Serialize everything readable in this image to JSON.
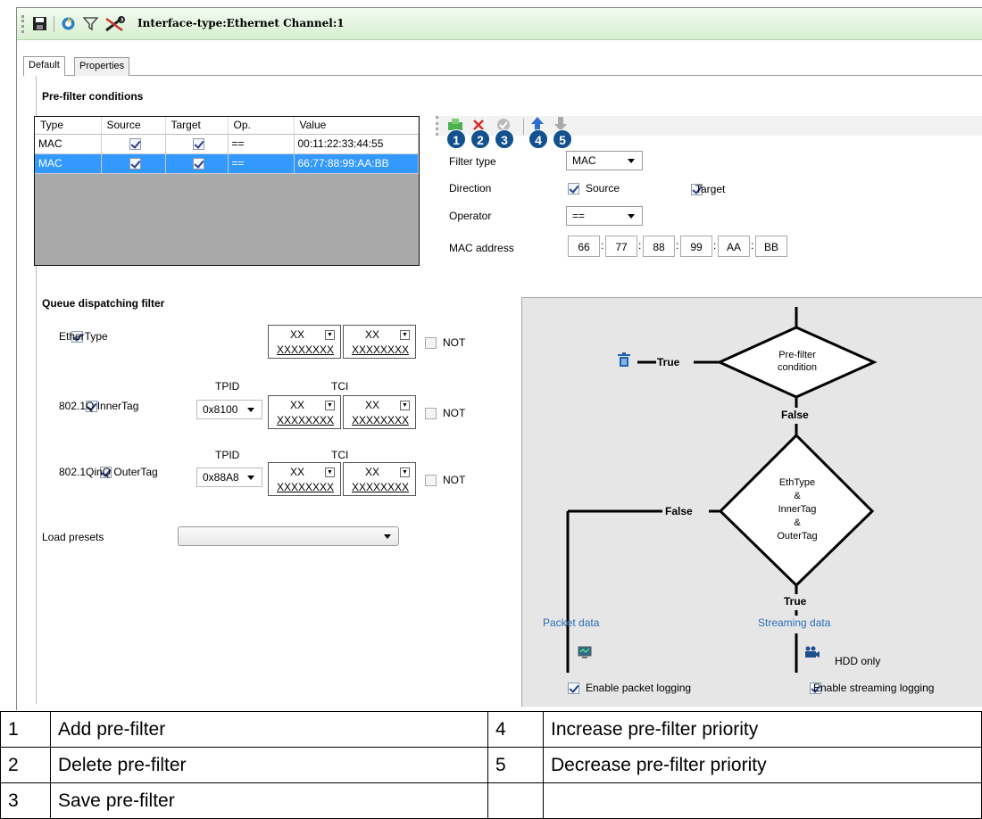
{
  "window": {
    "title": "Interface-type:Ethernet Channel:1"
  },
  "tabs": [
    {
      "label": "Default"
    },
    {
      "label": "Properties"
    }
  ],
  "prefilter": {
    "section_title": "Pre-filter conditions",
    "columns": [
      "Type",
      "Source",
      "Target",
      "Op.",
      "Value"
    ],
    "rows": [
      {
        "type": "MAC",
        "op": "==",
        "value": "00:11:22:33:44:55"
      },
      {
        "type": "MAC",
        "op": "==",
        "value": "66:77:88:99:AA:BB"
      }
    ]
  },
  "toolbar": {
    "numbers": [
      "1",
      "2",
      "3",
      "4",
      "5"
    ]
  },
  "form": {
    "filter_type_label": "Filter type",
    "filter_type_value": "MAC",
    "direction_label": "Direction",
    "source_label": "Source",
    "target_label": "Target",
    "operator_label": "Operator",
    "operator_value": "==",
    "mac_label": "MAC address",
    "mac": [
      "66",
      "77",
      "88",
      "99",
      "AA",
      "BB"
    ]
  },
  "queue": {
    "section_title": "Queue dispatching filter",
    "ethertype_label": "EtherType",
    "inner_label": "802.1Q InnerTag",
    "outer_label": "802.1QinQ OuterTag",
    "tpid_header": "TPID",
    "tci_header": "TCI",
    "inner_tpid": "0x8100",
    "outer_tpid": "0x88A8",
    "hex_top": "XX",
    "hex_bottom": "XXXXXXXX",
    "not_label": "NOT",
    "presets_label": "Load presets"
  },
  "diagram": {
    "prefilter_condition": "Pre-filter condition",
    "prefilter_line1": "Pre-filter",
    "prefilter_line2": "condition",
    "eth_lines": [
      "EthType",
      "&",
      "InnerTag",
      "&",
      "OuterTag"
    ],
    "true_label": "True",
    "false_label": "False",
    "packet_data": "Packet data",
    "streaming_data": "Streaming data",
    "hdd_only": "HDD only",
    "enable_packet": "Enable packet logging",
    "enable_streaming": "Enable streaming logging"
  },
  "legend": [
    {
      "n1": "1",
      "t1": "Add pre-filter",
      "n2": "4",
      "t2": "Increase pre-filter priority"
    },
    {
      "n1": "2",
      "t1": "Delete pre-filter",
      "n2": "5",
      "t2": "Decrease pre-filter priority"
    },
    {
      "n1": "3",
      "t1": "Save pre-filter",
      "n2": "",
      "t2": ""
    }
  ],
  "colors": {
    "accent": "#12508e",
    "selection": "#3399ff",
    "link": "#2a6fb8"
  }
}
